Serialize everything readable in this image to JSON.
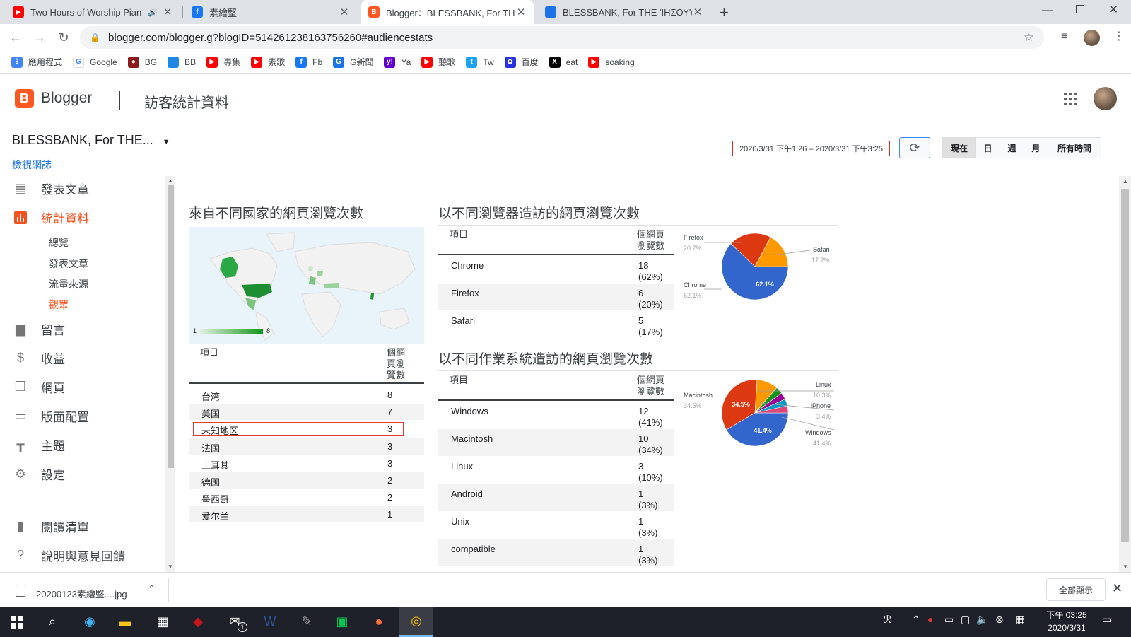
{
  "browser": {
    "tabs": [
      {
        "title": "Two Hours of Worship Pian",
        "favicon": "youtube-icon",
        "color": "#ff0000"
      },
      {
        "title": "素繪堅",
        "favicon": "facebook-icon",
        "color": "#1877f2"
      },
      {
        "title": "Blogger：BLESSBANK, For THE",
        "favicon": "blogger-icon",
        "color": "#ff5722"
      },
      {
        "title": "BLESSBANK, For THE 'ΙΗΣΟΥ'(In",
        "favicon": "blog-icon",
        "color": "#1a73e8"
      }
    ],
    "new_tab": "+",
    "url": "blogger.com/blogger.g?blogID=5142612381637562​60#audiencestats",
    "bookmarks": [
      {
        "label": "應用程式",
        "icon": "apps-grid-icon",
        "color": "#4285f4"
      },
      {
        "label": "Google",
        "icon": "google-icon",
        "color": "#4285f4"
      },
      {
        "label": "BG",
        "icon": "bg-icon",
        "color": "#8b1a1a"
      },
      {
        "label": "BB",
        "icon": "bb-icon",
        "color": "#1e88e5"
      },
      {
        "label": "專集",
        "icon": "youtube-icon",
        "color": "#ff0000"
      },
      {
        "label": "素歌",
        "icon": "youtube-icon",
        "color": "#ff0000"
      },
      {
        "label": "Fb",
        "icon": "facebook-icon",
        "color": "#1877f2"
      },
      {
        "label": "G新聞",
        "icon": "gnews-icon",
        "color": "#1a73e8"
      },
      {
        "label": "Ya",
        "icon": "yahoo-icon",
        "color": "#6001d2"
      },
      {
        "label": "聽歌",
        "icon": "youtube-icon",
        "color": "#ff0000"
      },
      {
        "label": "Tw",
        "icon": "twitter-icon",
        "color": "#1da1f2"
      },
      {
        "label": "百度",
        "icon": "baidu-icon",
        "color": "#2932e1"
      },
      {
        "label": "eat",
        "icon": "x-icon",
        "color": "#000000"
      },
      {
        "label": "soaking",
        "icon": "youtube-icon",
        "color": "#ff0000"
      }
    ]
  },
  "header": {
    "brand": "Blogger",
    "page_title": "訪客統計資料"
  },
  "blog": {
    "name": "BLESSBANK, For THE...",
    "view_link": "檢視網誌"
  },
  "date_controls": {
    "range": "2020/3/31 下午1:26 – 2020/3/31 下午3:25",
    "buttons": [
      "現在",
      "日",
      "週",
      "月",
      "所有時間"
    ],
    "selected": "現在"
  },
  "sidebar": {
    "items": [
      {
        "label": "發表文章",
        "icon": "posts-icon"
      },
      {
        "label": "統計資料",
        "icon": "stats-icon",
        "active": true
      },
      {
        "label": "留言",
        "icon": "comments-icon"
      },
      {
        "label": "收益",
        "icon": "earnings-icon"
      },
      {
        "label": "網頁",
        "icon": "pages-icon"
      },
      {
        "label": "版面配置",
        "icon": "layout-icon"
      },
      {
        "label": "主題",
        "icon": "theme-icon"
      },
      {
        "label": "設定",
        "icon": "settings-icon"
      },
      {
        "label": "閱讀清單",
        "icon": "bookmark-icon"
      },
      {
        "label": "說明與意見回饋",
        "icon": "help-icon"
      }
    ],
    "sub_items": [
      "總覽",
      "發表文章",
      "流量來源",
      "觀眾"
    ],
    "active_sub": "觀眾"
  },
  "country": {
    "heading": "來自不同國家的網頁瀏覽次數",
    "legend_min": "1",
    "legend_max": "8",
    "col_item": "項目",
    "col_views": "個網頁瀏覽數",
    "rows": [
      {
        "name": "台湾",
        "views": "8"
      },
      {
        "name": "美国",
        "views": "7"
      },
      {
        "name": "未知地区",
        "views": "3"
      },
      {
        "name": "法国",
        "views": "3"
      },
      {
        "name": "土耳其",
        "views": "3"
      },
      {
        "name": "德国",
        "views": "2"
      },
      {
        "name": "墨西哥",
        "views": "2"
      },
      {
        "name": "爱尔兰",
        "views": "1"
      }
    ]
  },
  "browsers": {
    "heading": "以不同瀏覽器造訪的網頁瀏覽次數",
    "col_item": "項目",
    "col_views": "個網頁瀏覽數",
    "rows": [
      {
        "name": "Chrome",
        "views": "18",
        "pct": "(62%)"
      },
      {
        "name": "Firefox",
        "views": "6",
        "pct": "(20%)"
      },
      {
        "name": "Safari",
        "views": "5",
        "pct": "(17%)"
      }
    ],
    "pie": {
      "center_label": "62.1%",
      "slices": [
        {
          "label": "Chrome",
          "value": 62.1,
          "display": "62.1%",
          "color": "#3366cc"
        },
        {
          "label": "Firefox",
          "value": 20.7,
          "display": "20.7%",
          "color": "#dc3912"
        },
        {
          "label": "Safari",
          "value": 17.2,
          "display": "17.2%",
          "color": "#ff9900"
        }
      ]
    }
  },
  "os": {
    "heading": "以不同作業系統造訪的網頁瀏覽次數",
    "col_item": "項目",
    "col_views": "個網頁瀏覽數",
    "rows": [
      {
        "name": "Windows",
        "views": "12",
        "pct": "(41%)"
      },
      {
        "name": "Macintosh",
        "views": "10",
        "pct": "(34%)"
      },
      {
        "name": "Linux",
        "views": "3",
        "pct": "(10%)"
      },
      {
        "name": "Android",
        "views": "1",
        "pct": "(3%)"
      },
      {
        "name": "Unix",
        "views": "1",
        "pct": "(3%)"
      },
      {
        "name": "compatible",
        "views": "1",
        "pct": "(3%)"
      }
    ],
    "pie": {
      "labels_shown": [
        {
          "label": "Macintosh",
          "display": "34.5%"
        },
        {
          "label": "Linux",
          "display": "10.3%"
        },
        {
          "label": "iPhone",
          "display": "3.4%"
        },
        {
          "label": "Windows",
          "display": "41.4%"
        }
      ],
      "inner_labels": [
        "34.5%",
        "41.4%"
      ],
      "slices": [
        {
          "label": "Windows",
          "value": 41.4,
          "color": "#3366cc"
        },
        {
          "label": "Macintosh",
          "value": 34.5,
          "color": "#dc3912"
        },
        {
          "label": "Linux",
          "value": 10.3,
          "color": "#ff9900"
        },
        {
          "label": "Android",
          "value": 3.4,
          "color": "#109618"
        },
        {
          "label": "Unix",
          "value": 3.4,
          "color": "#990099"
        },
        {
          "label": "compatible",
          "value": 3.4,
          "color": "#0099c6"
        },
        {
          "label": "iPhone",
          "value": 3.4,
          "color": "#dd4477"
        }
      ]
    }
  },
  "download": {
    "file": "20200123素繪堅....jpg",
    "show_all": "全部顯示"
  },
  "taskbar": {
    "time_ampm": "下午 03:25",
    "date": "2020/3/31",
    "mail_badge": "1"
  }
}
